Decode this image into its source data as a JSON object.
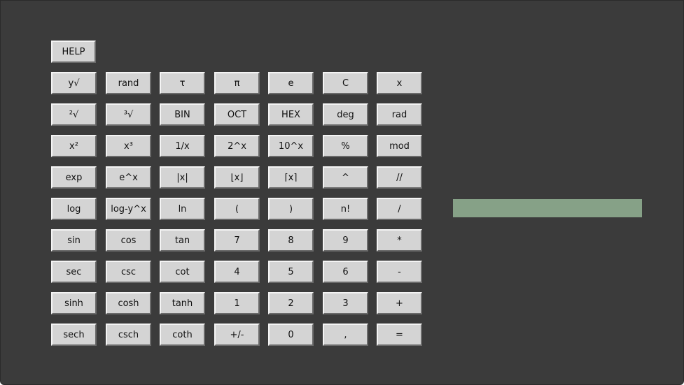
{
  "help_label": "HELP",
  "display": {
    "value": ""
  },
  "keypad": [
    [
      "y√",
      "rand",
      "τ",
      "π",
      "e",
      "C",
      "x"
    ],
    [
      "²√",
      "³√",
      "BIN",
      "OCT",
      "HEX",
      "deg",
      "rad"
    ],
    [
      "x²",
      "x³",
      "1/x",
      "2^x",
      "10^x",
      "%",
      "mod"
    ],
    [
      "exp",
      "e^x",
      "|x|",
      "⌊x⌋",
      "⌈x⌉",
      "^",
      "//"
    ],
    [
      "log",
      "log-y^x",
      "ln",
      "(",
      ")",
      "n!",
      "/"
    ],
    [
      "sin",
      "cos",
      "tan",
      "7",
      "8",
      "9",
      "*"
    ],
    [
      "sec",
      "csc",
      "cot",
      "4",
      "5",
      "6",
      "-"
    ],
    [
      "sinh",
      "cosh",
      "tanh",
      "1",
      "2",
      "3",
      "+"
    ],
    [
      "sech",
      "csch",
      "coth",
      "+/-",
      "0",
      ",",
      "="
    ]
  ],
  "colors": {
    "window_bg": "#3b3b3b",
    "button_bg": "#d4d4d4",
    "display_bg": "#86a187"
  }
}
